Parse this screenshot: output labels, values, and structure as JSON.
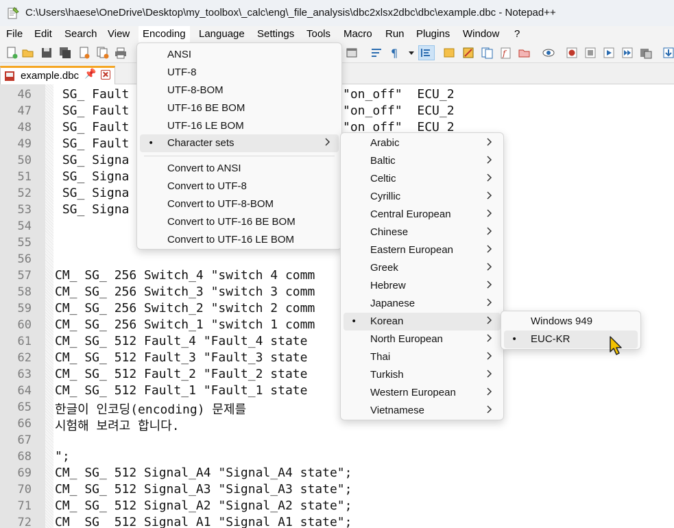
{
  "window": {
    "title": "C:\\Users\\haese\\OneDrive\\Desktop\\my_toolbox\\_calc\\eng\\_file_analysis\\dbc2xlsx2dbc\\dbc\\example.dbc - Notepad++"
  },
  "menubar": {
    "file": "File",
    "edit": "Edit",
    "search": "Search",
    "view": "View",
    "encoding": "Encoding",
    "language": "Language",
    "settings": "Settings",
    "tools": "Tools",
    "macro": "Macro",
    "run": "Run",
    "plugins": "Plugins",
    "window": "Window",
    "help": "?"
  },
  "tab": {
    "label": "example.dbc",
    "pin": "📌"
  },
  "editor": {
    "lines": [
      {
        "num": "46",
        "text": " SG_ Fault"
      },
      {
        "num": "47",
        "text": " SG_ Fault"
      },
      {
        "num": "48",
        "text": " SG_ Fault"
      },
      {
        "num": "49",
        "text": " SG_ Fault"
      },
      {
        "num": "50",
        "text": " SG_ Signa"
      },
      {
        "num": "51",
        "text": " SG_ Signa"
      },
      {
        "num": "52",
        "text": " SG_ Signa"
      },
      {
        "num": "53",
        "text": " SG_ Signa"
      },
      {
        "num": "54",
        "text": ""
      },
      {
        "num": "55",
        "text": ""
      },
      {
        "num": "56",
        "text": ""
      },
      {
        "num": "57",
        "text": "CM_ SG_ 256 Switch_4 \"switch 4 comm"
      },
      {
        "num": "58",
        "text": "CM_ SG_ 256 Switch_3 \"switch 3 comm"
      },
      {
        "num": "59",
        "text": "CM_ SG_ 256 Switch_2 \"switch 2 comm"
      },
      {
        "num": "60",
        "text": "CM_ SG_ 256 Switch_1 \"switch 1 comm"
      },
      {
        "num": "61",
        "text": "CM_ SG_ 512 Fault_4 \"Fault_4 state"
      },
      {
        "num": "62",
        "text": "CM_ SG_ 512 Fault_3 \"Fault_3 state"
      },
      {
        "num": "63",
        "text": "CM_ SG_ 512 Fault_2 \"Fault_2 state"
      },
      {
        "num": "64",
        "text": "CM_ SG_ 512 Fault_1 \"Fault_1 state"
      },
      {
        "num": "65",
        "text": "한글이 인코딩(encoding) 문제를"
      },
      {
        "num": "66",
        "text": "시험해 보려고 합니다."
      },
      {
        "num": "67",
        "text": ""
      },
      {
        "num": "68",
        "text": "\";"
      },
      {
        "num": "69",
        "text": "CM_ SG_ 512 Signal_A4 \"Signal_A4 state\";"
      },
      {
        "num": "70",
        "text": "CM_ SG_ 512 Signal_A3 \"Signal_A3 state\";"
      },
      {
        "num": "71",
        "text": "CM_ SG_ 512 Signal_A2 \"Signal_A2 state\";"
      },
      {
        "num": "72",
        "text": "CM_ SG_ 512 Signal_A1 \"Signal_A1 state\";"
      }
    ],
    "right_fragments": [
      {
        "line": "46",
        "text": "\"on_off\"  ECU_2"
      },
      {
        "line": "47",
        "text": "\"on_off\"  ECU_2"
      },
      {
        "line": "48",
        "text": "\"on_off\"  ECU_2"
      }
    ]
  },
  "encoding_menu": {
    "items": [
      {
        "label": "ANSI"
      },
      {
        "label": "UTF-8"
      },
      {
        "label": "UTF-8-BOM"
      },
      {
        "label": "UTF-16 BE BOM"
      },
      {
        "label": "UTF-16 LE BOM"
      },
      {
        "label": "Character sets",
        "bullet": "•",
        "submenu": true
      }
    ],
    "convert_items": [
      {
        "label": "Convert to ANSI"
      },
      {
        "label": "Convert to UTF-8"
      },
      {
        "label": "Convert to UTF-8-BOM"
      },
      {
        "label": "Convert to UTF-16 BE BOM"
      },
      {
        "label": "Convert to UTF-16 LE BOM"
      }
    ]
  },
  "charset_menu": {
    "items": [
      {
        "label": "Arabic"
      },
      {
        "label": "Baltic"
      },
      {
        "label": "Celtic"
      },
      {
        "label": "Cyrillic"
      },
      {
        "label": "Central European"
      },
      {
        "label": "Chinese"
      },
      {
        "label": "Eastern European"
      },
      {
        "label": "Greek"
      },
      {
        "label": "Hebrew"
      },
      {
        "label": "Japanese"
      },
      {
        "label": "Korean",
        "bullet": "•"
      },
      {
        "label": "North European"
      },
      {
        "label": "Thai"
      },
      {
        "label": "Turkish"
      },
      {
        "label": "Western European"
      },
      {
        "label": "Vietnamese"
      }
    ]
  },
  "korean_menu": {
    "items": [
      {
        "label": "Windows 949"
      },
      {
        "label": "EUC-KR",
        "bullet": "•"
      }
    ]
  },
  "icons": {
    "app": "notepad-plus-plus-icon",
    "cursor": "mouse-pointer-icon"
  },
  "colors": {
    "tab_accent": "#f5a623",
    "close_red": "#c0392b",
    "cursor_yellow": "#f2c200"
  }
}
